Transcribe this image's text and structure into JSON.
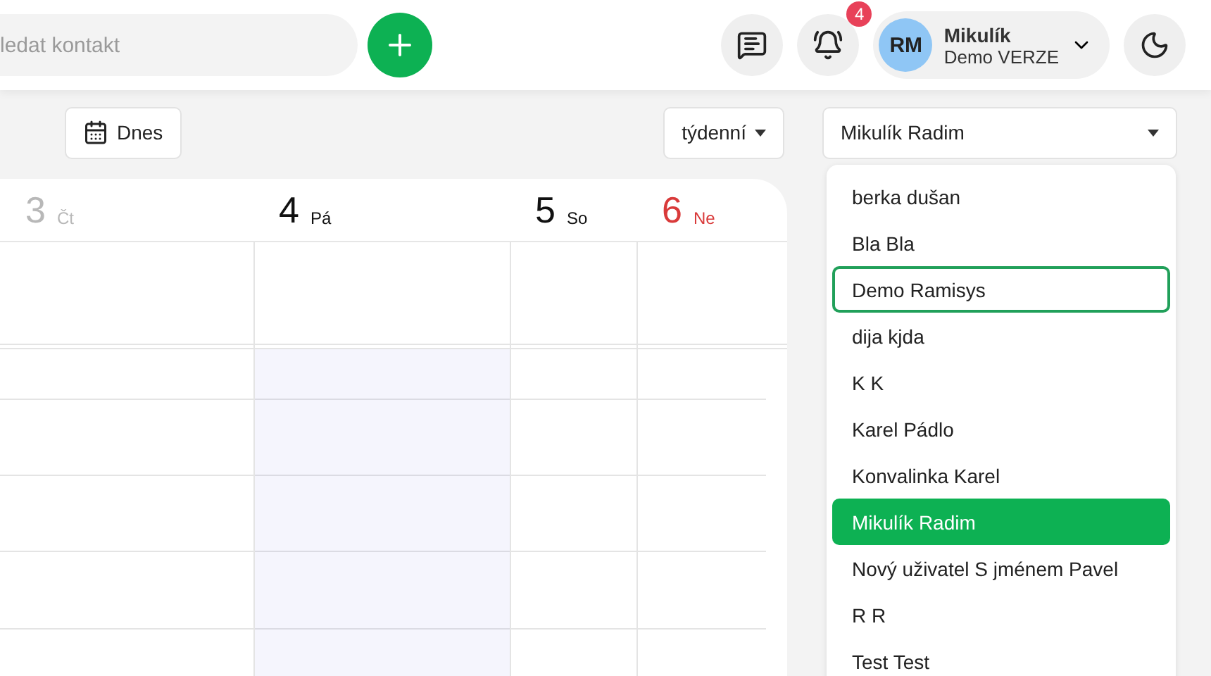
{
  "header": {
    "search": {
      "placeholder": "ledat kontakt"
    },
    "notifications": {
      "count": "4"
    },
    "user": {
      "initials": "RM",
      "name": "Mikulík",
      "subtitle": "Demo VERZE"
    }
  },
  "toolbar": {
    "today_button": "Dnes",
    "view_select": "týdenní",
    "person_select": "Mikulík Radim"
  },
  "calendar": {
    "days": [
      {
        "number": "3",
        "name": "Čt",
        "kind": "past",
        "today": false
      },
      {
        "number": "4",
        "name": "Pá",
        "kind": "normal",
        "today": true
      },
      {
        "number": "5",
        "name": "So",
        "kind": "normal",
        "today": false
      },
      {
        "number": "6",
        "name": "Ne",
        "kind": "sunday",
        "today": false
      }
    ]
  },
  "person_dropdown": {
    "items": [
      {
        "label": "berka dušan",
        "selected": false,
        "focused": false
      },
      {
        "label": "Bla Bla",
        "selected": false,
        "focused": false
      },
      {
        "label": "Demo Ramisys",
        "selected": false,
        "focused": true
      },
      {
        "label": "dija kjda",
        "selected": false,
        "focused": false
      },
      {
        "label": "K K",
        "selected": false,
        "focused": false
      },
      {
        "label": "Karel Pádlo",
        "selected": false,
        "focused": false
      },
      {
        "label": "Konvalinka Karel",
        "selected": false,
        "focused": false
      },
      {
        "label": "Mikulík Radim",
        "selected": true,
        "focused": false
      },
      {
        "label": "Nový uživatel S jménem Pavel",
        "selected": false,
        "focused": false
      },
      {
        "label": "R R",
        "selected": false,
        "focused": false
      },
      {
        "label": "Test Test",
        "selected": false,
        "focused": false
      }
    ]
  }
}
